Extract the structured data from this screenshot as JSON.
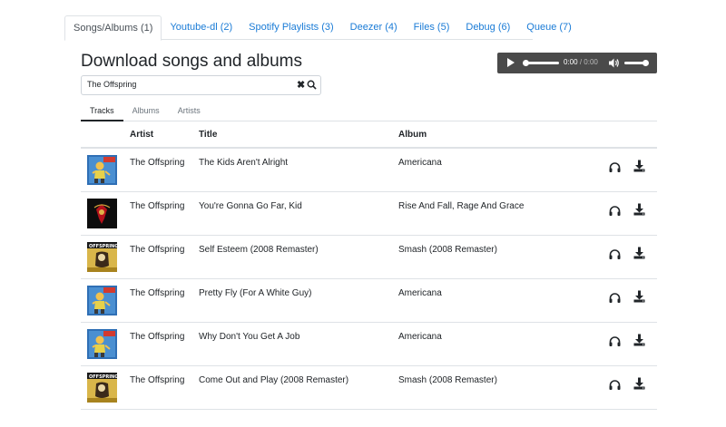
{
  "top_tabs": [
    {
      "label": "Songs/Albums (1)",
      "active": true
    },
    {
      "label": "Youtube-dl (2)",
      "active": false
    },
    {
      "label": "Spotify Playlists (3)",
      "active": false
    },
    {
      "label": "Deezer (4)",
      "active": false
    },
    {
      "label": "Files (5)",
      "active": false
    },
    {
      "label": "Debug (6)",
      "active": false
    },
    {
      "label": "Queue (7)",
      "active": false
    }
  ],
  "page_title": "Download songs and albums",
  "player": {
    "current_time": "0:00",
    "separator": "/",
    "duration": "0:00",
    "progress": 0,
    "volume": 1.0,
    "icons": [
      "play-icon",
      "volume-icon"
    ]
  },
  "search": {
    "value": "The Offspring",
    "icons": [
      "clear-icon",
      "search-icon"
    ]
  },
  "sub_tabs": [
    {
      "label": "Tracks",
      "active": true
    },
    {
      "label": "Albums",
      "active": false
    },
    {
      "label": "Artists",
      "active": false
    }
  ],
  "table": {
    "headers": {
      "artist": "Artist",
      "title": "Title",
      "album": "Album"
    },
    "rows": [
      {
        "cover": "americana",
        "artist": "The Offspring",
        "title": "The Kids Aren't Alright",
        "album": "Americana"
      },
      {
        "cover": "rise-and-fall",
        "artist": "The Offspring",
        "title": "You're Gonna Go Far, Kid",
        "album": "Rise And Fall, Rage And Grace"
      },
      {
        "cover": "smash",
        "artist": "The Offspring",
        "title": "Self Esteem (2008 Remaster)",
        "album": "Smash (2008 Remaster)"
      },
      {
        "cover": "americana",
        "artist": "The Offspring",
        "title": "Pretty Fly (For A White Guy)",
        "album": "Americana"
      },
      {
        "cover": "americana",
        "artist": "The Offspring",
        "title": "Why Don't You Get A Job",
        "album": "Americana"
      },
      {
        "cover": "smash",
        "artist": "The Offspring",
        "title": "Come Out and Play (2008 Remaster)",
        "album": "Smash (2008 Remaster)"
      }
    ],
    "row_icons": [
      "headphones-icon",
      "download-icon"
    ]
  },
  "colors": {
    "link": "#1a7bd6",
    "player_bg": "#4a4a4a",
    "border": "#dee2e6"
  }
}
